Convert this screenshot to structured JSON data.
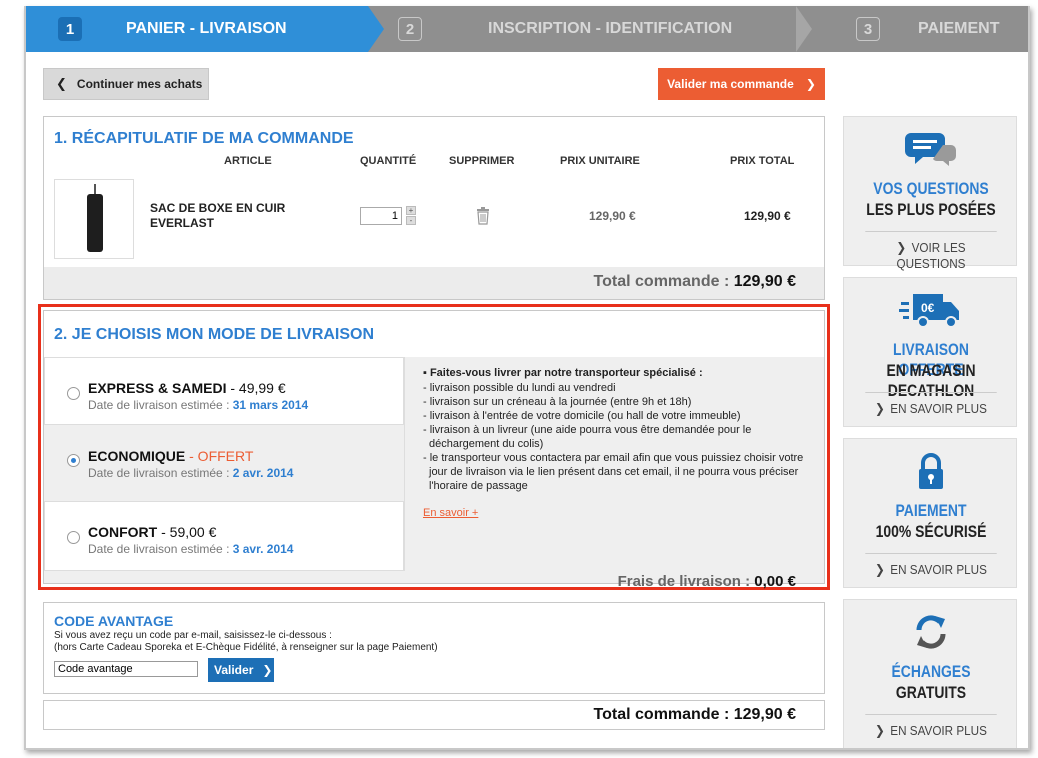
{
  "steps": [
    {
      "number": "1",
      "label": "PANIER - LIVRAISON",
      "active": true
    },
    {
      "number": "2",
      "label": "INSCRIPTION - IDENTIFICATION",
      "active": false
    },
    {
      "number": "3",
      "label": "PAIEMENT",
      "active": false
    }
  ],
  "toolbar": {
    "continue_label": "Continuer mes achats",
    "validate_label": "Valider ma commande"
  },
  "recap": {
    "title": "1. RÉCAPITULATIF DE MA COMMANDE",
    "columns": [
      "ARTICLE",
      "QUANTITÉ",
      "SUPPRIMER",
      "PRIX UNITAIRE",
      "PRIX TOTAL"
    ],
    "item": {
      "name": "SAC DE BOXE EN CUIR EVERLAST",
      "quantity": "1",
      "unit_price": "129,90 €",
      "total_price": "129,90 €"
    },
    "total_label": "Total commande :",
    "total_value": "129,90 €"
  },
  "delivery": {
    "title": "2. JE CHOISIS MON MODE DE LIVRAISON",
    "date_prefix": "Date de livraison estimée :",
    "options": [
      {
        "name": "EXPRESS & SAMEDI",
        "price": " - 49,99 €",
        "date": "31 mars 2014",
        "selected": false
      },
      {
        "name": "ECONOMIQUE",
        "price": " - OFFERT",
        "date": "2 avr. 2014",
        "selected": true
      },
      {
        "name": "CONFORT",
        "price": " - 59,00 €",
        "date": "3 avr. 2014",
        "selected": false
      }
    ],
    "info_title": "▪ Faites-vous livrer par notre transporteur spécialisé :",
    "info_lines": [
      "- livraison possible du lundi au vendredi",
      "- livraison sur un créneau à la journée (entre 9h et 18h)",
      "- livraison à l'entrée de votre domicile (ou hall de votre immeuble)",
      "- livraison à un livreur (une aide pourra vous être demandée pour le déchargement du colis)",
      "- le transporteur vous contactera par email afin que vous puissiez choisir votre jour de livraison via le lien présent dans cet email, il ne pourra vous préciser l'horaire de passage"
    ],
    "more_link": "En savoir +",
    "fee_label": "Frais de livraison :",
    "fee_value": "0,00 €"
  },
  "code": {
    "title": "CODE AVANTAGE",
    "line1": "Si vous avez reçu un code par e-mail, saisissez-le ci-dessous :",
    "line2": "(hors Carte Cadeau Sporeka et E-Chèque Fidélité, à renseigner sur la page Paiement)",
    "input_value": "Code avantage",
    "button_label": "Valider"
  },
  "final_total": "Total commande : 129,90 €",
  "sidebar": [
    {
      "line1": "VOS QUESTIONS",
      "line2": "LES PLUS POSÉES",
      "link": "VOIR LES QUESTIONS",
      "icon": "chat-bubbles-icon"
    },
    {
      "line1": "LIVRAISON OFFERTE",
      "line2": "EN MAGASIN DECATHLON",
      "link": "EN SAVOIR PLUS",
      "icon": "delivery-truck-icon",
      "badge": "0€"
    },
    {
      "line1": "PAIEMENT",
      "line2": "100% SÉCURISÉ",
      "link": "EN SAVOIR PLUS",
      "icon": "padlock-icon"
    },
    {
      "line1": "ÉCHANGES",
      "line2": "GRATUITS",
      "link": "EN SAVOIR PLUS",
      "icon": "exchange-arrows-icon"
    }
  ],
  "colors": {
    "brand_blue": "#2f7fd0",
    "accent_orange": "#ec5d33",
    "highlight_red": "#e8301b"
  }
}
